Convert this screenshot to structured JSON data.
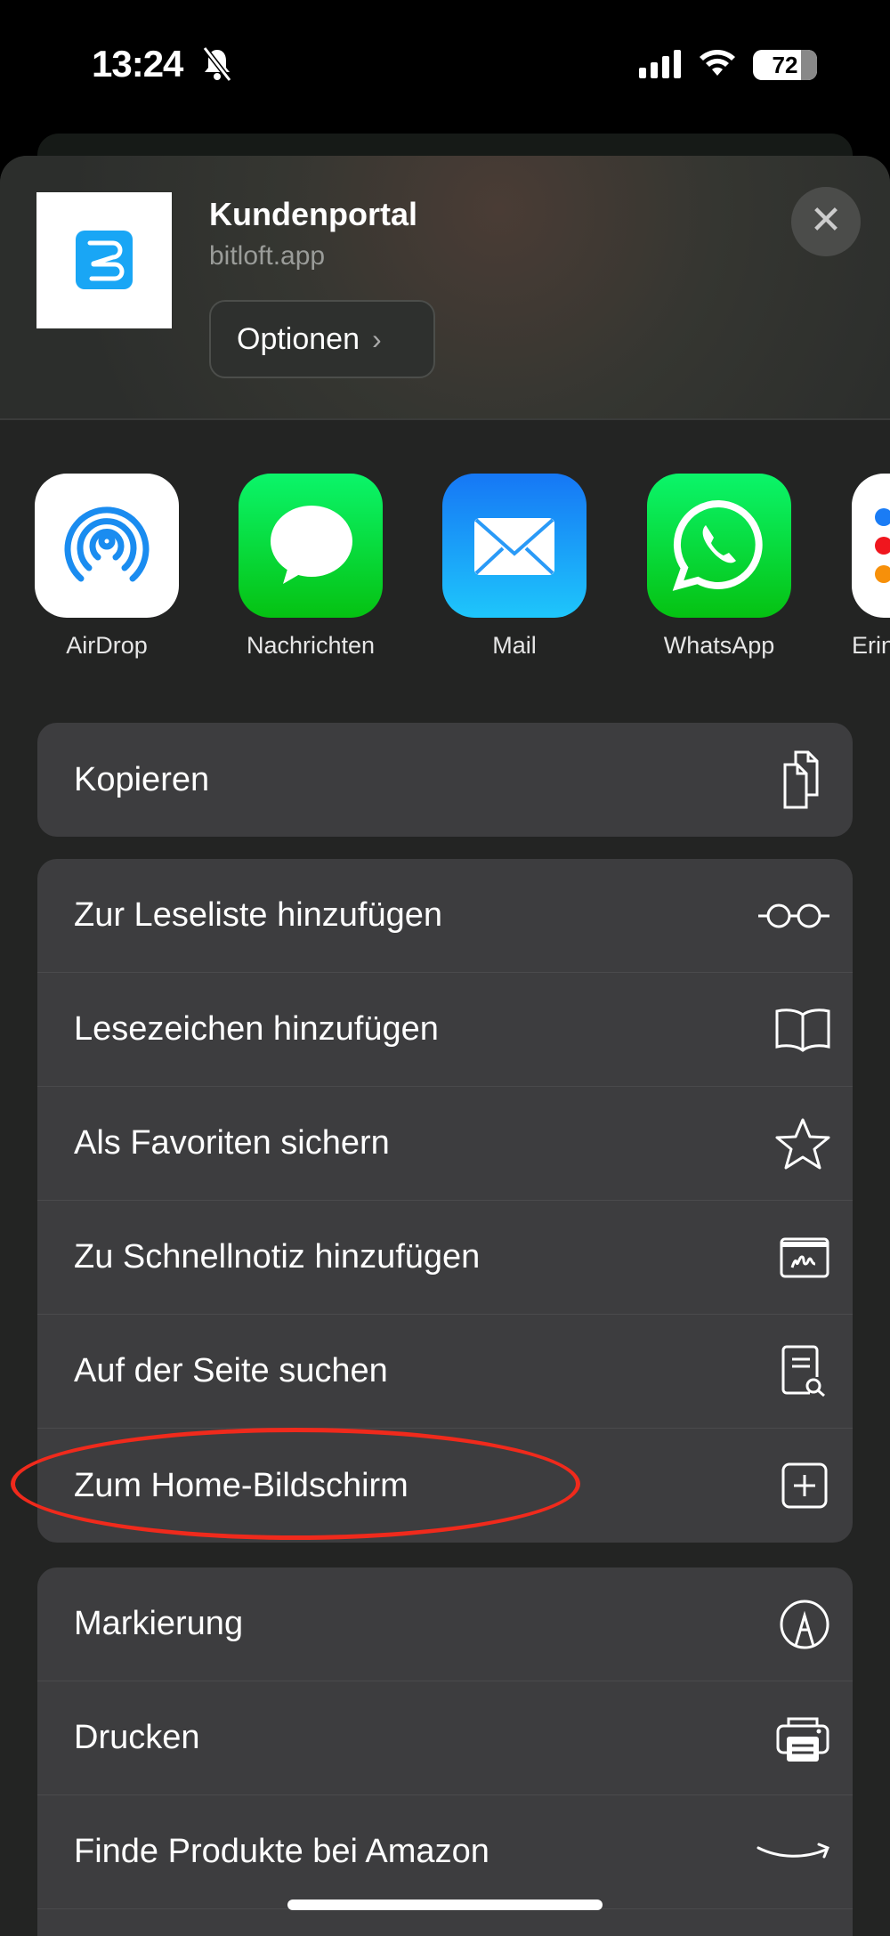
{
  "status_bar": {
    "time": "13:24",
    "battery": "72",
    "silent": true
  },
  "header": {
    "title": "Kundenportal",
    "subtitle": "bitloft.app",
    "options_label": "Optionen",
    "close_label": "Schließen"
  },
  "apps": [
    {
      "label": "AirDrop",
      "icon": "airdrop-icon"
    },
    {
      "label": "Nachrichten",
      "icon": "messages-icon"
    },
    {
      "label": "Mail",
      "icon": "mail-icon"
    },
    {
      "label": "WhatsApp",
      "icon": "whatsapp-icon"
    },
    {
      "label": "Erin",
      "icon": "reminders-icon"
    }
  ],
  "group1": [
    {
      "label": "Kopieren",
      "icon": "copy-icon"
    }
  ],
  "group2": [
    {
      "label": "Zur Leseliste hinzufügen",
      "icon": "glasses-icon"
    },
    {
      "label": "Lesezeichen hinzufügen",
      "icon": "book-icon"
    },
    {
      "label": "Als Favoriten sichern",
      "icon": "star-icon"
    },
    {
      "label": "Zu Schnellnotiz hinzufügen",
      "icon": "quick-note-icon"
    },
    {
      "label": "Auf der Seite suchen",
      "icon": "find-in-page-icon"
    },
    {
      "label": "Zum Home-Bildschirm",
      "icon": "add-square-icon",
      "highlighted": true
    }
  ],
  "group3": [
    {
      "label": "Markierung",
      "icon": "markup-icon"
    },
    {
      "label": "Drucken",
      "icon": "printer-icon"
    },
    {
      "label": "Finde Produkte bei Amazon",
      "icon": "amazon-icon"
    }
  ],
  "colors": {
    "highlight": "#f02a1c",
    "sheet": "#232423",
    "row": "#3d3d3f",
    "brand": "#19a6f5"
  }
}
